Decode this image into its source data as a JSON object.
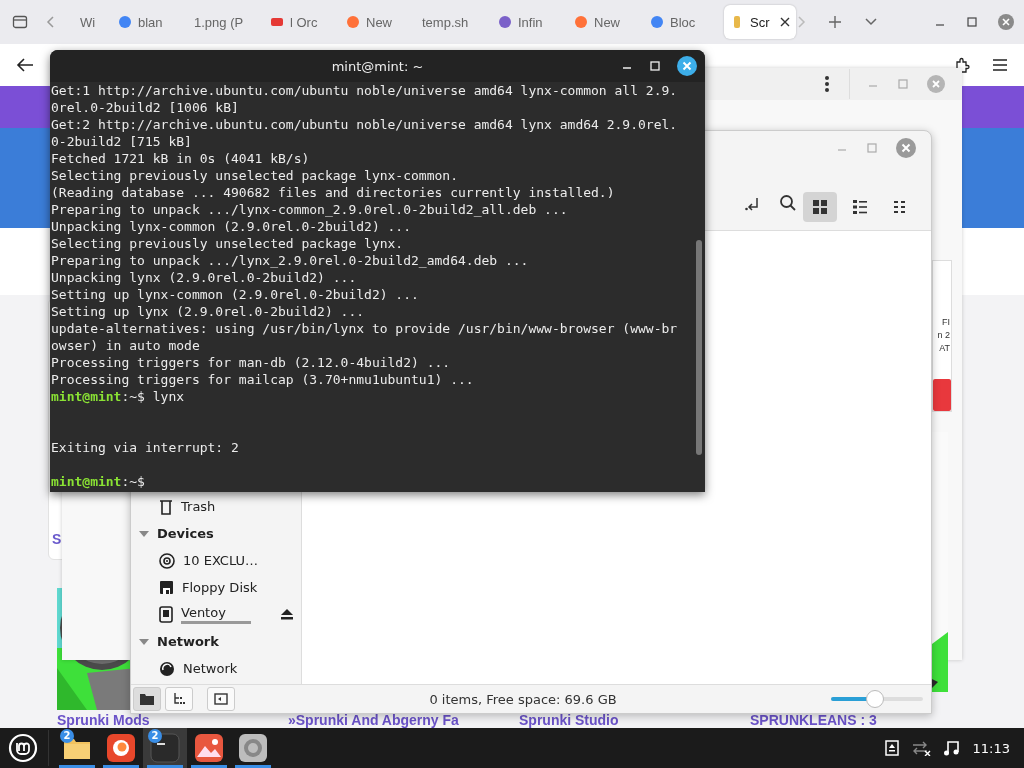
{
  "browser": {
    "tabs": [
      {
        "label": "Wi",
        "kind": "plain",
        "selected": false
      },
      {
        "label": "blan",
        "kind": "search",
        "selected": false
      },
      {
        "label": "1.png (P",
        "kind": "plain",
        "selected": false
      },
      {
        "label": "l Orc",
        "kind": "video",
        "selected": false
      },
      {
        "label": "New",
        "kind": "newtab",
        "selected": false
      },
      {
        "label": "temp.sh",
        "kind": "plain",
        "selected": false
      },
      {
        "label": "Infin",
        "kind": "site",
        "selected": false
      },
      {
        "label": "New",
        "kind": "newtab",
        "selected": false
      },
      {
        "label": "Bloc",
        "kind": "search",
        "selected": false
      },
      {
        "label": "Scr",
        "kind": "page",
        "selected": true
      }
    ],
    "page": {
      "left_card_text": "S",
      "side_card_lines": [
        "FI",
        "n 2",
        "AT"
      ],
      "card_titles": [
        "Sprunki Mods",
        "»Sprunki And Abgerny Fa",
        "Sprunki Studio",
        "SPRUNKLEANS : 3"
      ]
    }
  },
  "terminal": {
    "title": "mint@mint: ~",
    "lines": [
      {
        "kind": "output",
        "text": "Get:1 http://archive.ubuntu.com/ubuntu noble/universe amd64 lynx-common all 2.9."
      },
      {
        "kind": "output",
        "text": "0rel.0-2build2 [1006 kB]"
      },
      {
        "kind": "output",
        "text": "Get:2 http://archive.ubuntu.com/ubuntu noble/universe amd64 lynx amd64 2.9.0rel."
      },
      {
        "kind": "output",
        "text": "0-2build2 [715 kB]"
      },
      {
        "kind": "output",
        "text": "Fetched 1721 kB in 0s (4041 kB/s)"
      },
      {
        "kind": "output",
        "text": "Selecting previously unselected package lynx-common."
      },
      {
        "kind": "output",
        "text": "(Reading database ... 490682 files and directories currently installed.)"
      },
      {
        "kind": "output",
        "text": "Preparing to unpack .../lynx-common_2.9.0rel.0-2build2_all.deb ..."
      },
      {
        "kind": "output",
        "text": "Unpacking lynx-common (2.9.0rel.0-2build2) ..."
      },
      {
        "kind": "output",
        "text": "Selecting previously unselected package lynx."
      },
      {
        "kind": "output",
        "text": "Preparing to unpack .../lynx_2.9.0rel.0-2build2_amd64.deb ..."
      },
      {
        "kind": "output",
        "text": "Unpacking lynx (2.9.0rel.0-2build2) ..."
      },
      {
        "kind": "output",
        "text": "Setting up lynx-common (2.9.0rel.0-2build2) ..."
      },
      {
        "kind": "output",
        "text": "Setting up lynx (2.9.0rel.0-2build2) ..."
      },
      {
        "kind": "output",
        "text": "update-alternatives: using /usr/bin/lynx to provide /usr/bin/www-browser (www-br"
      },
      {
        "kind": "output",
        "text": "owser) in auto mode"
      },
      {
        "kind": "output",
        "text": "Processing triggers for man-db (2.12.0-4build2) ..."
      },
      {
        "kind": "output",
        "text": "Processing triggers for mailcap (3.70+nmu1ubuntu1) ..."
      },
      {
        "kind": "prompt",
        "user": "mint@mint",
        "path": ":~$",
        "command": "lynx"
      },
      {
        "kind": "blank"
      },
      {
        "kind": "blank"
      },
      {
        "kind": "output",
        "text": "Exiting via interrupt: 2"
      },
      {
        "kind": "blank"
      },
      {
        "kind": "prompt",
        "user": "mint@mint",
        "path": ":~$"
      }
    ]
  },
  "file_manager": {
    "views": [
      {
        "kind": "icons",
        "selected": true
      },
      {
        "kind": "list",
        "selected": false
      },
      {
        "kind": "compact",
        "selected": false
      }
    ],
    "sidebar": [
      {
        "kind": "trash",
        "label": "Trash"
      },
      {
        "kind": "heading",
        "label": "Devices",
        "expanded": true,
        "children": [
          {
            "kind": "disc",
            "label": "10 EXCLU…"
          },
          {
            "kind": "floppy",
            "label": "Floppy Disk"
          },
          {
            "kind": "drive",
            "label": "Ventoy",
            "level": 1,
            "eject": true
          }
        ]
      },
      {
        "kind": "heading",
        "label": "Network",
        "expanded": true,
        "children": [
          {
            "kind": "network",
            "label": "Network"
          }
        ]
      }
    ],
    "status": "0 items, Free space: 69.6 GB",
    "zoom": {
      "level": 0.47
    }
  },
  "taskbar": {
    "apps": [
      {
        "kind": "files",
        "badge": "2",
        "running": true,
        "selected": false
      },
      {
        "kind": "firefox",
        "running": true,
        "selected": false
      },
      {
        "kind": "terminal",
        "badge": "2",
        "running": true,
        "selected": true
      },
      {
        "kind": "images",
        "running": true,
        "selected": false
      },
      {
        "kind": "app",
        "running": true,
        "selected": false
      }
    ],
    "clock": "11:13"
  }
}
